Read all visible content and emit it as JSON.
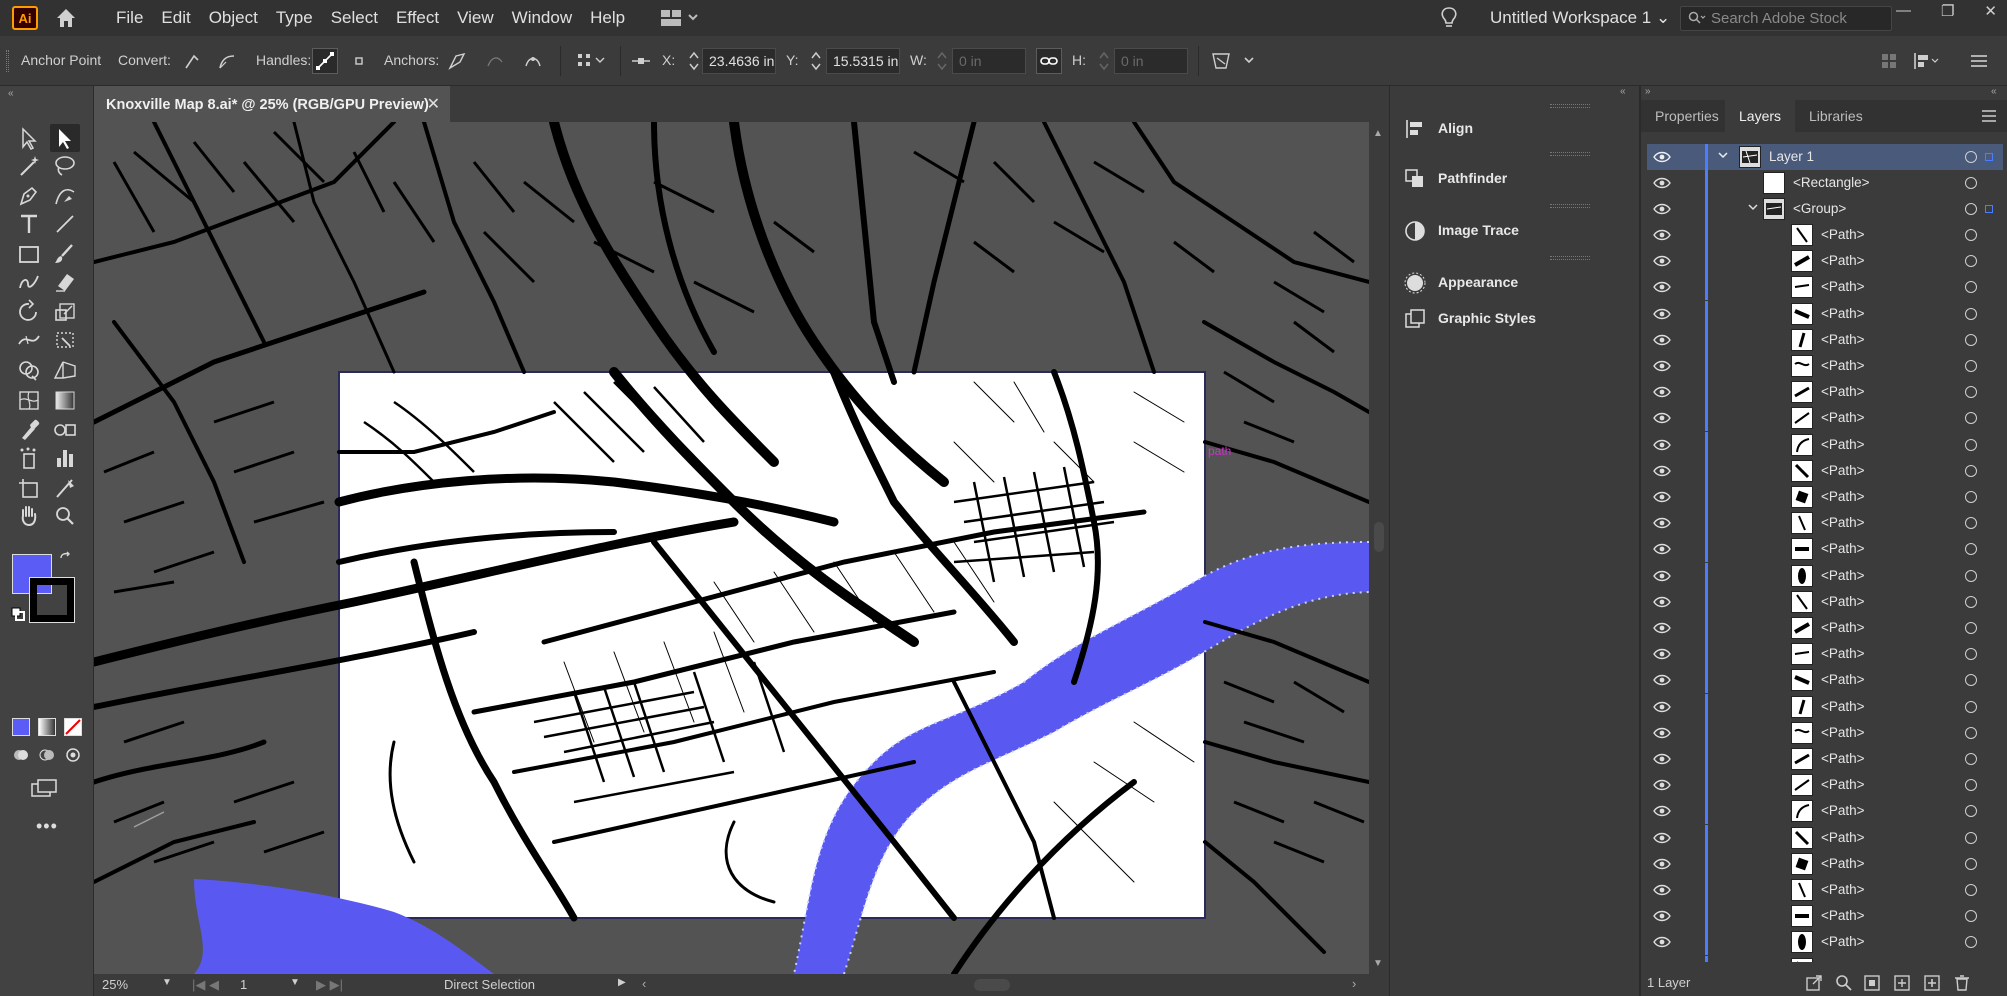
{
  "app": {
    "logo_text": "Ai",
    "menu": [
      "File",
      "Edit",
      "Object",
      "Type",
      "Select",
      "Effect",
      "View",
      "Window",
      "Help"
    ],
    "workspace": "Untitled Workspace 1",
    "stock_search_placeholder": "Search Adobe Stock",
    "window_controls": [
      "—",
      "❐",
      "✕"
    ]
  },
  "control_bar": {
    "mode_label": "Anchor Point",
    "convert_label": "Convert:",
    "handles_label": "Handles:",
    "anchors_label": "Anchors:",
    "x_label": "X:",
    "x_value": "23.4636 in",
    "y_label": "Y:",
    "y_value": "15.5315 in",
    "w_label": "W:",
    "w_value": "0 in",
    "h_label": "H:",
    "h_value": "0 in"
  },
  "document": {
    "tab_title": "Knoxville Map 8.ai* @ 25% (RGB/GPU Preview)",
    "close_glyph": "✕",
    "path_hover_label": "path"
  },
  "status_bar": {
    "zoom": "25%",
    "artboard": "1",
    "tool_status": "Direct Selection"
  },
  "colors": {
    "fill": "#5b5bf5",
    "stroke": "#000000",
    "accent": "#4b7dff",
    "canvas": "#535353",
    "water": "#5959f2"
  },
  "mid_panels": [
    {
      "label": "Align",
      "icon": "align-icon"
    },
    {
      "label": "Pathfinder",
      "icon": "pathfinder-icon"
    },
    {
      "label": "Image Trace",
      "icon": "image-trace-icon"
    },
    {
      "label": "Appearance",
      "icon": "appearance-icon"
    },
    {
      "label": "Graphic Styles",
      "icon": "graphic-styles-icon"
    }
  ],
  "layers_panel": {
    "tabs": [
      "Properties",
      "Layers",
      "Libraries"
    ],
    "active_tab": "Layers",
    "layer_name": "Layer 1",
    "rectangle_name": "<Rectangle>",
    "group_name": "<Group>",
    "path_name": "<Path>",
    "path_count": 29,
    "footer": "1 Layer"
  }
}
